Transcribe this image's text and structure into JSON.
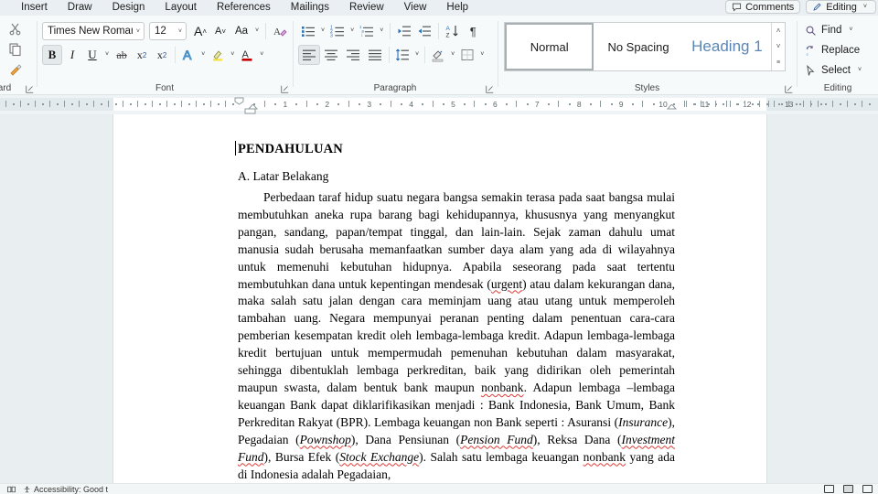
{
  "tabs": [
    {
      "label": "Insert"
    },
    {
      "label": "Draw"
    },
    {
      "label": "Design"
    },
    {
      "label": "Layout"
    },
    {
      "label": "References"
    },
    {
      "label": "Mailings"
    },
    {
      "label": "Review"
    },
    {
      "label": "View"
    },
    {
      "label": "Help"
    }
  ],
  "titlebar": {
    "comments_label": "Comments",
    "editing_label": "Editing",
    "comments_icon": "comment-bubble-icon",
    "editing_icon": "pen-icon",
    "editing_caret": "˅"
  },
  "ribbon": {
    "groups": [
      {
        "name": "clipboard",
        "label": "ard"
      },
      {
        "name": "font",
        "label": "Font"
      },
      {
        "name": "paragraph",
        "label": "Paragraph"
      },
      {
        "name": "styles",
        "label": "Styles"
      },
      {
        "name": "editing",
        "label": "Editing"
      }
    ],
    "clipboard": {
      "paste_icon": "paste-icon",
      "cut_icon": "scissors-icon",
      "copy_icon": "copy-icon",
      "format_painter_icon": "format-painter-icon",
      "dialog_launcher_icon": "dialog-launcher-icon"
    },
    "font": {
      "font_name": "Times New Roman",
      "font_size": "12",
      "grow_font_label": "A",
      "shrink_font_label": "A",
      "change_case_label": "Aa",
      "clear_formatting_label": "A",
      "bold_label": "B",
      "italic_label": "I",
      "underline_label": "U",
      "strikethrough_label": "ab",
      "subscript_label": "x",
      "subscript_sub": "2",
      "superscript_label": "x",
      "superscript_sup": "2",
      "text_effects_label": "A",
      "highlight_label": "",
      "font_color_label": "A",
      "dialog_launcher_icon": "dialog-launcher-icon",
      "bold_active": "true"
    },
    "paragraph": {
      "bullets_icon": "bullet-list-icon",
      "numbering_icon": "numbered-list-icon",
      "multilevel_icon": "multilevel-list-icon",
      "decrease_indent_icon": "decrease-indent-icon",
      "increase_indent_icon": "increase-indent-icon",
      "sort_icon": "sort-az-icon",
      "show_marks_label": "¶",
      "align_left_icon": "align-left-icon",
      "align_center_icon": "align-center-icon",
      "align_right_icon": "align-right-icon",
      "justify_icon": "justify-icon",
      "line_spacing_icon": "line-spacing-icon",
      "shading_icon": "shading-icon",
      "borders_icon": "borders-icon",
      "dialog_launcher_icon": "dialog-launcher-icon",
      "align_left_active": "true"
    },
    "styles": {
      "items": [
        {
          "label": "Normal",
          "selected": true
        },
        {
          "label": "No Spacing",
          "selected": false
        },
        {
          "label": "Heading 1",
          "selected": false
        }
      ],
      "scroll_up": "˄",
      "scroll_down": "˅",
      "scroll_more": "☰",
      "dialog_launcher_icon": "dialog-launcher-icon"
    },
    "editing": {
      "find_label": "Find",
      "find_icon": "magnifier-icon",
      "find_caret": "˅",
      "replace_label": "Replace",
      "replace_icon": "replace-icon",
      "select_label": "Select",
      "select_icon": "cursor-arrow-icon",
      "select_caret": "˅"
    }
  },
  "ruler": {
    "numbers": [
      "1",
      "2",
      "3",
      "4",
      "5",
      "6",
      "7",
      "8",
      "9",
      "10",
      "11",
      "12",
      "13"
    ],
    "first_line_indent_marker": "first-line-indent-marker",
    "hanging_indent_marker": "hanging-indent-marker",
    "left_indent_marker": "left-indent-marker",
    "right_indent_marker": "right-indent-marker"
  },
  "document": {
    "title": "PENDAHULUAN",
    "subheading": "A. Latar Belakang",
    "paragraph_runs": [
      {
        "t": "Perbedaan taraf hidup suatu negara bangsa semakin terasa pada saat bangsa mulai membutuhkan aneka rupa barang bagi kehidupannya, khususnya yang menyangkut pangan, sandang, papan/tempat tinggal, dan lain-lain. Sejak zaman dahulu umat manusia sudah berusaha memanfaatkan sumber daya alam yang ada di wilayahnya untuk memenuhi kebutuhan hidupnya. Apabila seseorang pada saat tertentu membutuhkan dana untuk kepentingan mendesak ("
      },
      {
        "t": "urgent",
        "style": "spell"
      },
      {
        "t": ") atau dalam kekurangan dana, maka salah satu jalan dengan cara meminjam uang atau utang untuk memperoleh tambahan uang. Negara mempunyai peranan penting dalam penentuan cara-cara pemberian kesempatan kredit oleh lembaga-lembaga kredit. Adapun lembaga-lembaga kredit bertujuan untuk mempermudah pemenuhan kebutuhan dalam masyarakat, sehingga dibentuklah lembaga perkreditan, baik yang didirikan oleh pemerintah maupun swasta, dalam bentuk bank maupun "
      },
      {
        "t": "nonbank",
        "style": "spell"
      },
      {
        "t": ". Adapun lembaga –lembaga keuangan Bank dapat diklarifikasikan menjadi : Bank Indonesia, Bank Umum, Bank Perkreditan Rakyat (BPR). Lembaga keuangan non Bank seperti : Asuransi ("
      },
      {
        "t": "Insurance",
        "style": "italic"
      },
      {
        "t": "), Pegadaian ("
      },
      {
        "t": "Pownshop",
        "style": "italic-spell"
      },
      {
        "t": "), Dana Pensiunan ("
      },
      {
        "t": "Pension Fund",
        "style": "italic-spell"
      },
      {
        "t": "), Reksa Dana ("
      },
      {
        "t": "Investment Fund",
        "style": "italic-spell"
      },
      {
        "t": "), Bursa Efek ("
      },
      {
        "t": "Stock Exchange",
        "style": "italic-spell"
      },
      {
        "t": "). Salah satu lembaga keuangan "
      },
      {
        "t": "nonbank",
        "style": "spell"
      },
      {
        "t": " yang ada di Indonesia adalah Pegadaian,"
      }
    ]
  },
  "statusbar": {
    "accessibility_label": "Accessibility: Good t",
    "page_icon": "page-icon",
    "accessibility_icon": "accessibility-icon",
    "read_mode_icon": "read-mode-icon",
    "print_layout_icon": "print-layout-icon",
    "web_layout_icon": "web-layout-icon"
  },
  "colors": {
    "ribbon_bg": "#f7fafb",
    "tabbar_bg": "#e9eff2",
    "canvas_bg": "#e9eff1",
    "accent_blue": "#2b579a",
    "heading_blue": "#5b86b5",
    "spell_red": "#e03a34"
  }
}
